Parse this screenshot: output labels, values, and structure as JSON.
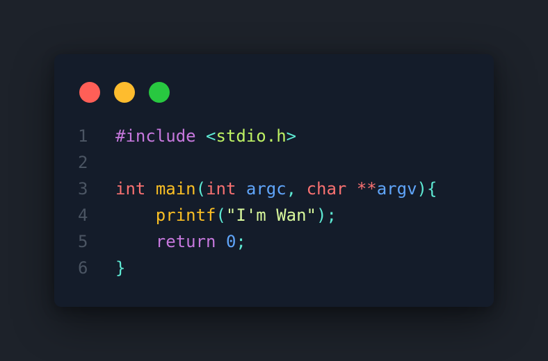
{
  "colors": {
    "background": "#1d222a",
    "window": "#141c2a",
    "dot_red": "#ff5f57",
    "dot_yellow": "#febc2e",
    "dot_green": "#28c840",
    "line_number": "#4b5563",
    "keyword_purple": "#c678dd",
    "type_red": "#f87171",
    "function_yellow": "#fbbf24",
    "string_green": "#d9f99d",
    "header_green": "#bef264",
    "param_blue": "#60a5fa",
    "punct_teal": "#5eead4",
    "number_blue": "#60a5fa"
  },
  "window_controls": [
    {
      "icon": "close-dot-icon",
      "color": "#ff5f57"
    },
    {
      "icon": "minimize-dot-icon",
      "color": "#febc2e"
    },
    {
      "icon": "zoom-dot-icon",
      "color": "#28c840"
    }
  ],
  "code": {
    "lines": [
      {
        "number": "1",
        "tokens": [
          {
            "text": "#include",
            "color": "#c678dd"
          },
          {
            "text": " ",
            "color": "#e5e7eb"
          },
          {
            "text": "<",
            "color": "#5eead4"
          },
          {
            "text": "stdio.h",
            "color": "#bef264"
          },
          {
            "text": ">",
            "color": "#5eead4"
          }
        ]
      },
      {
        "number": "2",
        "tokens": []
      },
      {
        "number": "3",
        "tokens": [
          {
            "text": "int",
            "color": "#f87171"
          },
          {
            "text": " ",
            "color": "#e5e7eb"
          },
          {
            "text": "main",
            "color": "#fbbf24"
          },
          {
            "text": "(",
            "color": "#5eead4"
          },
          {
            "text": "int",
            "color": "#f87171"
          },
          {
            "text": " ",
            "color": "#e5e7eb"
          },
          {
            "text": "argc",
            "color": "#60a5fa"
          },
          {
            "text": ", ",
            "color": "#5eead4"
          },
          {
            "text": "char",
            "color": "#f87171"
          },
          {
            "text": " ",
            "color": "#e5e7eb"
          },
          {
            "text": "**",
            "color": "#f87171"
          },
          {
            "text": "argv",
            "color": "#60a5fa"
          },
          {
            "text": "){",
            "color": "#5eead4"
          }
        ]
      },
      {
        "number": "4",
        "tokens": [
          {
            "text": "    ",
            "color": "#e5e7eb"
          },
          {
            "text": "printf",
            "color": "#fbbf24"
          },
          {
            "text": "(",
            "color": "#5eead4"
          },
          {
            "text": "\"I'm Wan\"",
            "color": "#d9f99d"
          },
          {
            "text": ");",
            "color": "#5eead4"
          }
        ]
      },
      {
        "number": "5",
        "tokens": [
          {
            "text": "    ",
            "color": "#e5e7eb"
          },
          {
            "text": "return",
            "color": "#c678dd"
          },
          {
            "text": " ",
            "color": "#e5e7eb"
          },
          {
            "text": "0",
            "color": "#60a5fa"
          },
          {
            "text": ";",
            "color": "#5eead4"
          }
        ]
      },
      {
        "number": "6",
        "tokens": [
          {
            "text": "}",
            "color": "#5eead4"
          }
        ]
      }
    ]
  }
}
